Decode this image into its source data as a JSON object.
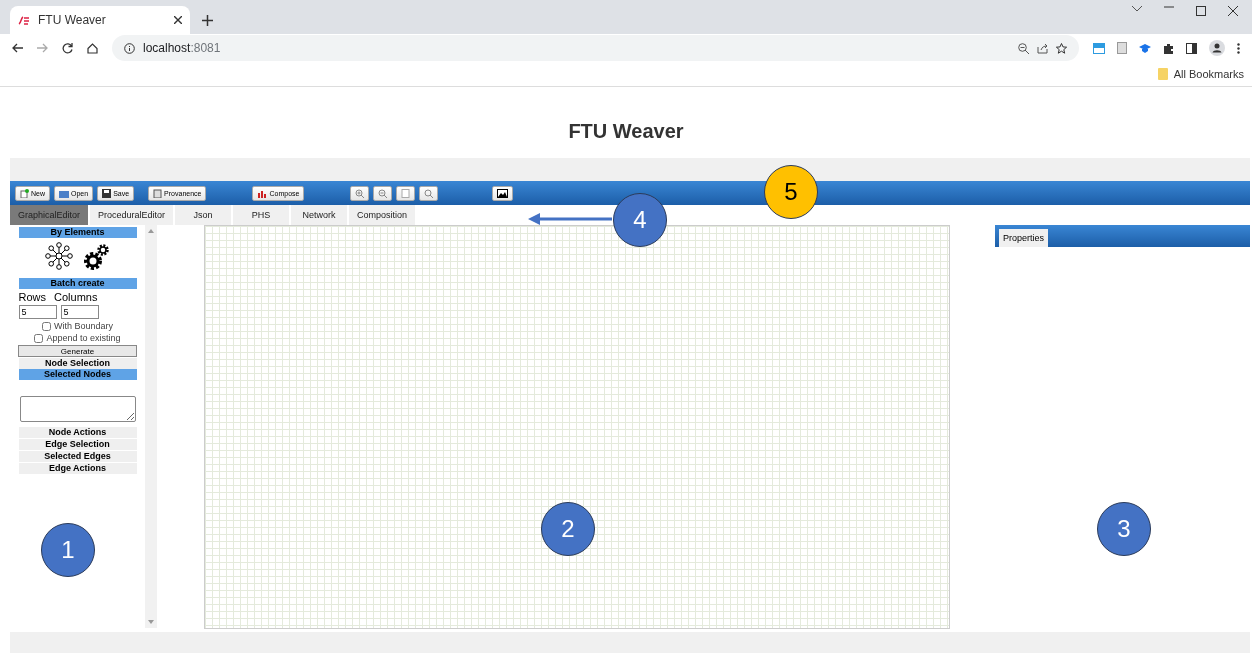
{
  "browser": {
    "tab_title": "FTU Weaver",
    "url_host": "localhost",
    "url_port": ":8081",
    "bookmarks": "All Bookmarks"
  },
  "page_title": "FTU Weaver",
  "toolbar": [
    {
      "kind": "text",
      "label": "New"
    },
    {
      "kind": "text",
      "label": "Open"
    },
    {
      "kind": "text",
      "label": "Save"
    },
    {
      "kind": "text",
      "label": "Provanence"
    },
    {
      "kind": "text",
      "label": "Compose"
    },
    {
      "kind": "icon"
    },
    {
      "kind": "icon"
    },
    {
      "kind": "icon"
    },
    {
      "kind": "icon"
    },
    {
      "kind": "icon"
    }
  ],
  "tabs": [
    {
      "label": "GraphicalEditor",
      "selected": true
    },
    {
      "label": "ProceduralEditor",
      "selected": false
    },
    {
      "label": "Json",
      "selected": false
    },
    {
      "label": "PHS",
      "selected": false
    },
    {
      "label": "Network",
      "selected": false
    },
    {
      "label": "Composition",
      "selected": false
    }
  ],
  "sidebar": {
    "by_elements": "By Elements",
    "batch_create": "Batch create",
    "rows_label": "Rows",
    "columns_label": "Columns",
    "rows_value": "5",
    "columns_value": "5",
    "options": [
      {
        "label": "With Boundary",
        "checked": false
      },
      {
        "label": "Append to existing",
        "checked": false
      }
    ],
    "generate": "Generate",
    "node_selection": "Node Selection",
    "selected_nodes": "Selected Nodes",
    "sections": [
      "Node Actions",
      "Edge Selection",
      "Selected Edges",
      "Edge Actions"
    ]
  },
  "properties": {
    "tab": "Properties"
  },
  "callouts": [
    {
      "label": "1",
      "color": "#4472c4"
    },
    {
      "label": "2",
      "color": "#4472c4"
    },
    {
      "label": "3",
      "color": "#4472c4"
    },
    {
      "label": "4",
      "color": "#4472c4"
    },
    {
      "label": "5",
      "color": "#ffc000"
    }
  ]
}
